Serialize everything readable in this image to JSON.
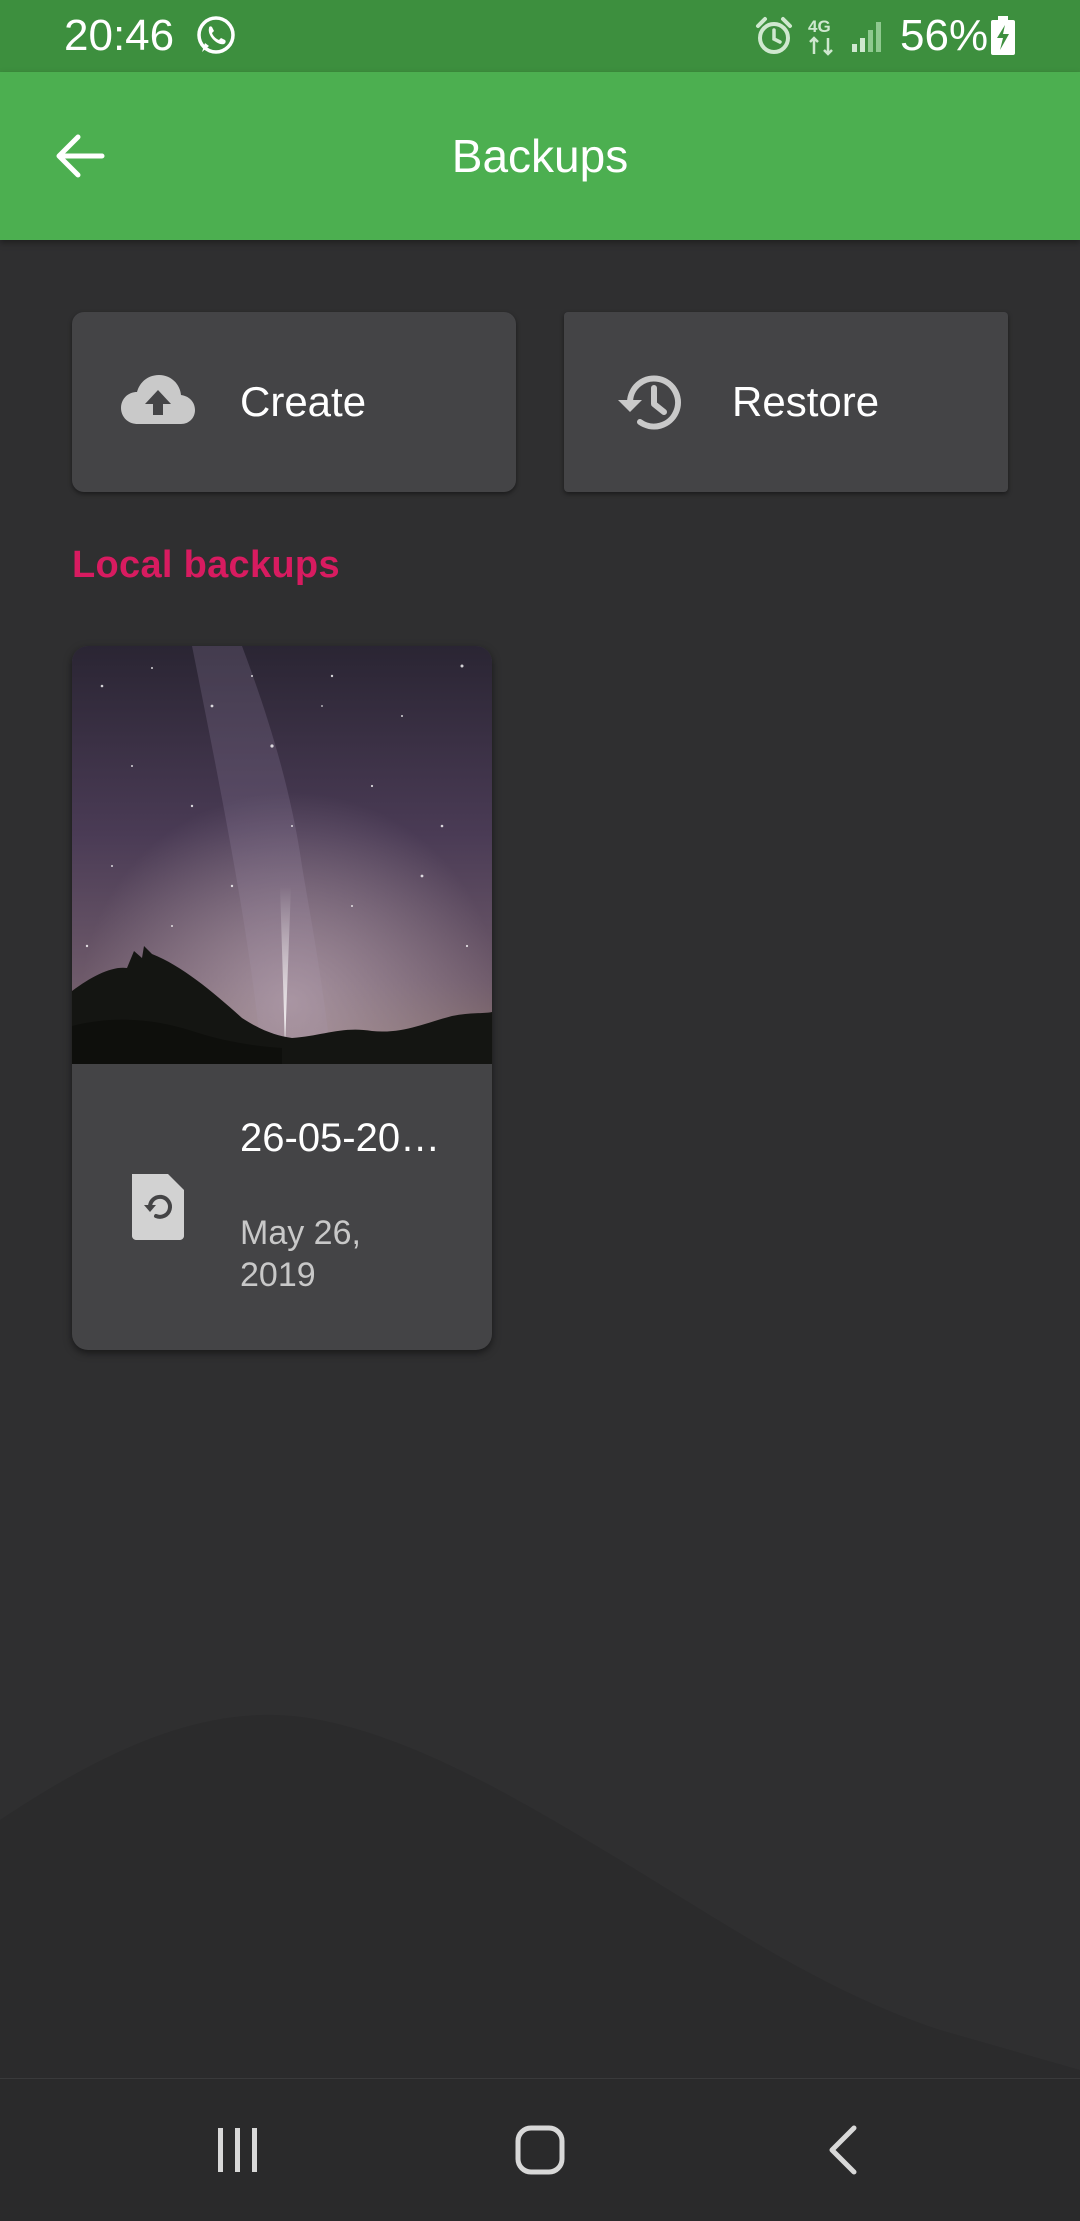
{
  "status_bar": {
    "time": "20:46",
    "battery_percent": "56%",
    "icons": [
      "whatsapp-icon",
      "alarm-icon",
      "4g-data-icon",
      "signal-icon",
      "battery-charging-icon"
    ]
  },
  "app_bar": {
    "title": "Backups",
    "back_icon": "arrow-back-icon"
  },
  "actions": {
    "create_label": "Create",
    "create_icon": "cloud-upload-icon",
    "restore_label": "Restore",
    "restore_icon": "history-icon"
  },
  "local_backups": {
    "header": "Local backups",
    "items": [
      {
        "name": "26-05-20…",
        "date": "May 26, 2019",
        "icon": "file-restore-icon",
        "thumbnail": "night-sky-milky-way"
      }
    ]
  },
  "nav_bar": {
    "icons": [
      "recents-icon",
      "home-icon",
      "back-icon"
    ]
  },
  "colors": {
    "status_bar": "#3d8f3e",
    "app_bar": "#4caf50",
    "background": "#2f2f30",
    "card": "#444446",
    "accent": "#d81b60"
  }
}
